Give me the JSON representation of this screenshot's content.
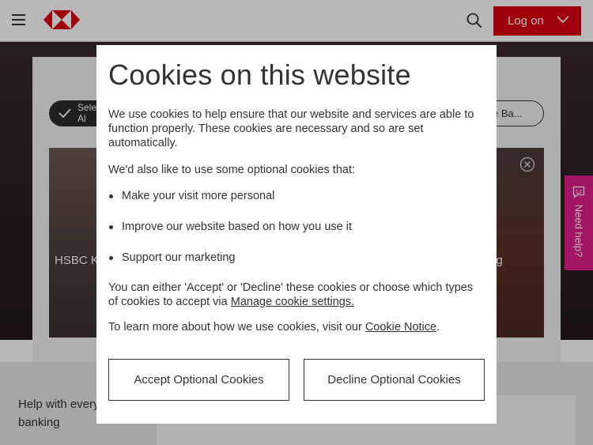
{
  "header": {
    "logon_label": "Log on",
    "brand_color": "#db0011",
    "icons": [
      "menu-icon",
      "hsbc-logo",
      "search-icon",
      "chevron-down-icon"
    ]
  },
  "background_page": {
    "pill_left_label_line1": "Sele",
    "pill_left_label_line2": "Al",
    "pill_right_label": "e Ba...",
    "tile_left_text": "HSBC K",
    "tile_right_text": "nking",
    "help_text": "Help with every business banking",
    "need_help_label": "Need help?",
    "need_help_color": "#e01e8a"
  },
  "cookie_modal": {
    "title": "Cookies on this website",
    "intro": "We use cookies to help ensure that our website and services are able to function properly. These cookies are necessary and so are set automatically.",
    "optional_intro": "We'd also like to use some optional cookies that:",
    "bullets": [
      "Make your visit more personal",
      "Improve our website based on how you use it",
      "Support our marketing"
    ],
    "either_text_before": "You can either 'Accept' or 'Decline' these cookies or choose which types of cookies to accept via ",
    "manage_link": "Manage cookie settings.",
    "learn_more_before": "To learn more about how we use cookies, visit our ",
    "cookie_notice_link": "Cookie Notice",
    "learn_more_after": ".",
    "accept_button": "Accept Optional Cookies",
    "decline_button": "Decline Optional Cookies"
  }
}
